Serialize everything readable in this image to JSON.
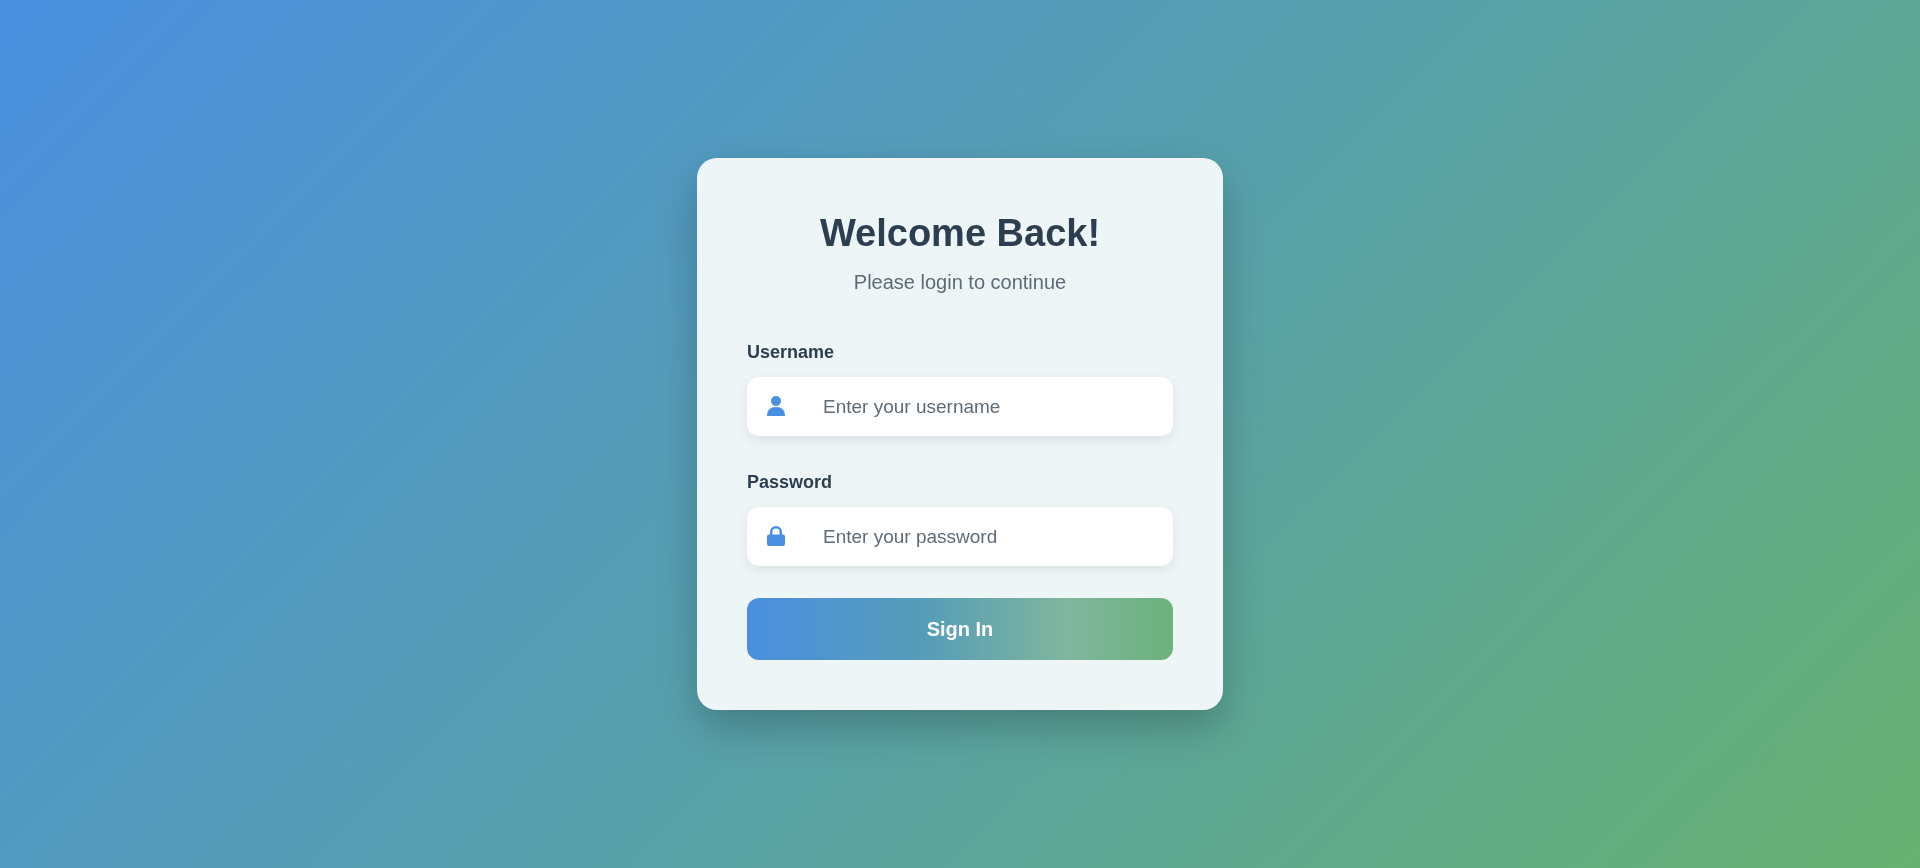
{
  "card": {
    "title": "Welcome Back!",
    "subtitle": "Please login to continue"
  },
  "fields": [
    {
      "kind": "text",
      "label": "Username",
      "placeholder": "Enter your username"
    },
    {
      "kind": "password",
      "label": "Password",
      "placeholder": "Enter your password"
    }
  ],
  "submit_button": {
    "label": "Sign In"
  }
}
